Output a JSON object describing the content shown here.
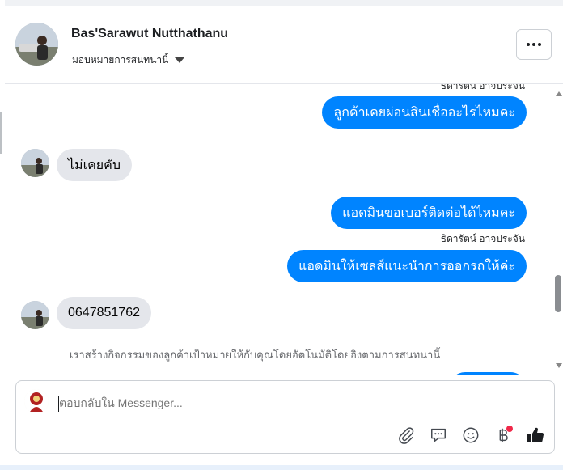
{
  "header": {
    "contact_name": "Bas'Sarawut Nutthathanu",
    "assign_label": "มอบหมายการสนทนานี้"
  },
  "messages": {
    "clipped_sender": "ธิดารัตน์ อาจประจัน",
    "out_1": "ลูกค้าเคยผ่อนสินเชื่ออะไรไหมคะ",
    "in_1": "ไม่เคยคับ",
    "out_2": "แอดมินขอเบอร์ติดต่อได้ไหมคะ",
    "sender_2": "ธิดารัตน์ อาจประจัน",
    "out_3": "แอดมินให้เซลส์แนะนำการออกรถให้ค่ะ",
    "in_2": "0647851762",
    "system_note": "เราสร้างกิจกรรมของลูกค้าเป้าหมายให้กับคุณโดยอัตโนมัติโดยอิงตามการสนทนานี้"
  },
  "composer": {
    "placeholder": "ตอบกลับใน Messenger..."
  },
  "icons": {
    "more": "more-options-icon",
    "attach": "paperclip-icon",
    "saved_replies": "chat-bubble-icon",
    "emoji": "smiley-icon",
    "payment": "baht-icon",
    "like": "thumbs-up-icon"
  },
  "colors": {
    "outgoing_bubble": "#0084ff",
    "incoming_bubble": "#e4e6eb",
    "notification_dot": "#f02849"
  }
}
